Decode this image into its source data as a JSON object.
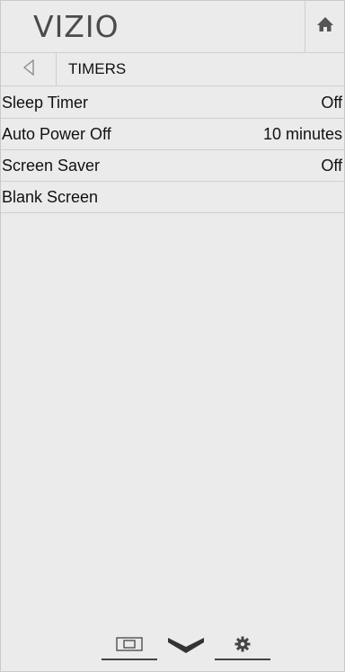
{
  "header": {
    "brand": "VIZIO",
    "home_icon": "home-icon"
  },
  "titlebar": {
    "back_icon": "back-arrow-icon",
    "title": "TIMERS"
  },
  "menu": {
    "items": [
      {
        "label": "Sleep Timer",
        "value": "Off"
      },
      {
        "label": "Auto Power Off",
        "value": "10 minutes"
      },
      {
        "label": "Screen Saver",
        "value": "Off"
      },
      {
        "label": "Blank Screen",
        "value": ""
      }
    ]
  },
  "bottom_bar": {
    "tabs": [
      {
        "icon": "input-icon"
      },
      {
        "icon": "vizio-v-icon"
      },
      {
        "icon": "gear-icon"
      }
    ]
  },
  "colors": {
    "background": "#ebebeb",
    "divider": "#cfcfcf",
    "text": "#111111",
    "brand": "#4b4b4b"
  }
}
